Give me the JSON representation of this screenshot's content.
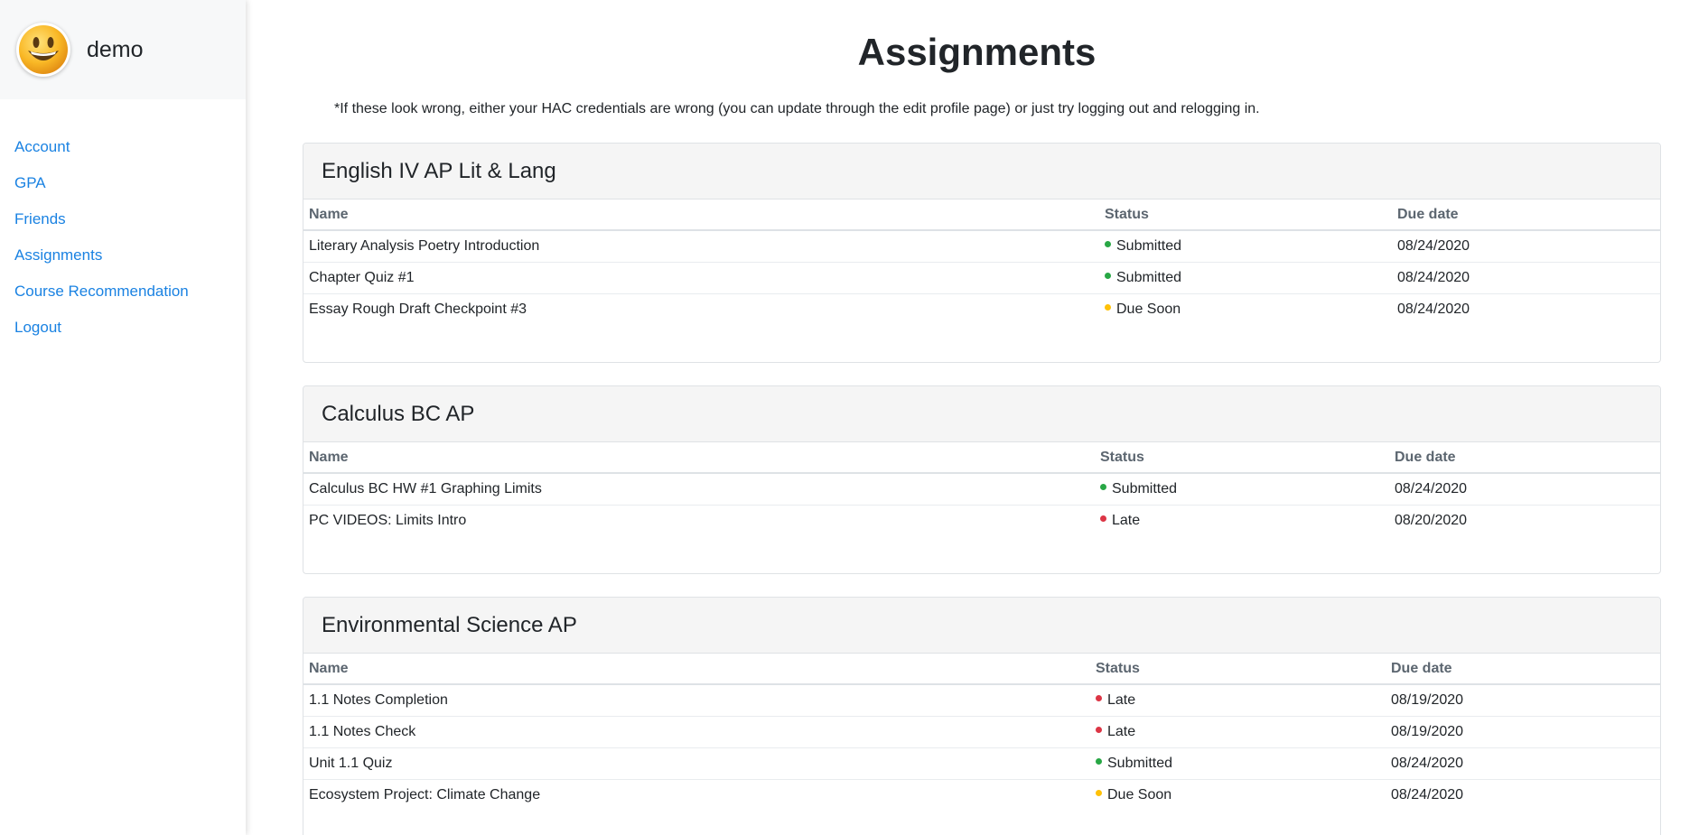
{
  "sidebar": {
    "username": "demo",
    "avatar_icon": "smiley-face-icon",
    "items": [
      {
        "label": "Account"
      },
      {
        "label": "GPA"
      },
      {
        "label": "Friends"
      },
      {
        "label": "Assignments"
      },
      {
        "label": "Course Recommendation"
      },
      {
        "label": "Logout"
      }
    ]
  },
  "main": {
    "title": "Assignments",
    "note": "*If these look wrong, either your HAC credentials are wrong (you can update through the edit profile page) or just try logging out and relogging in.",
    "columns": {
      "name": "Name",
      "status": "Status",
      "due": "Due date"
    },
    "courses": [
      {
        "name": "English IV AP Lit & Lang",
        "assignments": [
          {
            "name": "Literary Analysis Poetry Introduction",
            "status": "Submitted",
            "due": "08/24/2020"
          },
          {
            "name": "Chapter Quiz #1",
            "status": "Submitted",
            "due": "08/24/2020"
          },
          {
            "name": "Essay Rough Draft Checkpoint #3",
            "status": "Due Soon",
            "due": "08/24/2020"
          }
        ]
      },
      {
        "name": "Calculus BC AP",
        "assignments": [
          {
            "name": "Calculus BC HW #1 Graphing Limits",
            "status": "Submitted",
            "due": "08/24/2020"
          },
          {
            "name": "PC VIDEOS: Limits Intro",
            "status": "Late",
            "due": "08/20/2020"
          }
        ]
      },
      {
        "name": "Environmental Science AP",
        "assignments": [
          {
            "name": "1.1 Notes Completion",
            "status": "Late",
            "due": "08/19/2020"
          },
          {
            "name": "1.1 Notes Check",
            "status": "Late",
            "due": "08/19/2020"
          },
          {
            "name": "Unit 1.1 Quiz",
            "status": "Submitted",
            "due": "08/24/2020"
          },
          {
            "name": "Ecosystem Project: Climate Change",
            "status": "Due Soon",
            "due": "08/24/2020"
          }
        ]
      }
    ]
  },
  "colors": {
    "submitted": "#28a745",
    "due_soon": "#ffc107",
    "late": "#dc3545",
    "link": "#1a82e2"
  }
}
